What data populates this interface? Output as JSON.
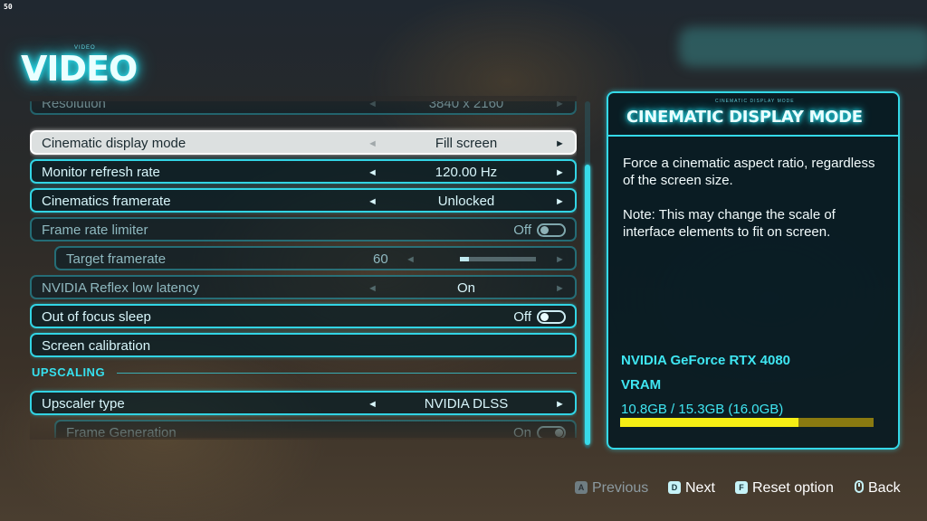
{
  "fps_counter": "50",
  "header": {
    "small_label": "VIDEO",
    "title": "VIDEO"
  },
  "settings": {
    "resolution": {
      "label": "Resolution",
      "value": "3840 x 2160"
    },
    "cinematic_display_mode": {
      "label": "Cinematic display mode",
      "value": "Fill screen"
    },
    "monitor_refresh_rate": {
      "label": "Monitor refresh rate",
      "value": "120.00 Hz"
    },
    "cinematics_framerate": {
      "label": "Cinematics framerate",
      "value": "Unlocked"
    },
    "frame_rate_limiter": {
      "label": "Frame rate limiter",
      "state": "Off"
    },
    "target_framerate": {
      "label": "Target framerate",
      "value": "60",
      "slider_fraction": 0.12
    },
    "nvidia_reflex": {
      "label": "NVIDIA Reflex low latency",
      "value": "On"
    },
    "out_of_focus_sleep": {
      "label": "Out of focus sleep",
      "state": "Off"
    },
    "screen_calibration": {
      "label": "Screen calibration"
    },
    "upscaling_section": "UPSCALING",
    "upscaler_type": {
      "label": "Upscaler type",
      "value": "NVIDIA DLSS"
    },
    "frame_generation": {
      "label": "Frame Generation",
      "state": "On"
    },
    "arrows": {
      "left": "◄",
      "right": "►"
    }
  },
  "info_panel": {
    "tiny_label": "CINEMATIC DISPLAY MODE",
    "title": "CINEMATIC DISPLAY MODE",
    "description_1": "Force a cinematic aspect ratio, regardless of the screen size.",
    "description_2": "Note: This may change the scale of interface elements to fit on screen.",
    "gpu_name": "NVIDIA GeForce RTX 4080",
    "vram_label": "VRAM",
    "vram_value": "10.8GB / 15.3GB (16.0GB)",
    "vram_fraction": 0.705
  },
  "footer": {
    "previous": {
      "key": "A",
      "label": "Previous"
    },
    "next": {
      "key": "D",
      "label": "Next"
    },
    "reset": {
      "key": "F",
      "label": "Reset option"
    },
    "back": {
      "label": "Back"
    }
  },
  "colors": {
    "accent": "#32d4e4",
    "vram_fill": "#f6ef14",
    "vram_track": "#8a7a10"
  }
}
